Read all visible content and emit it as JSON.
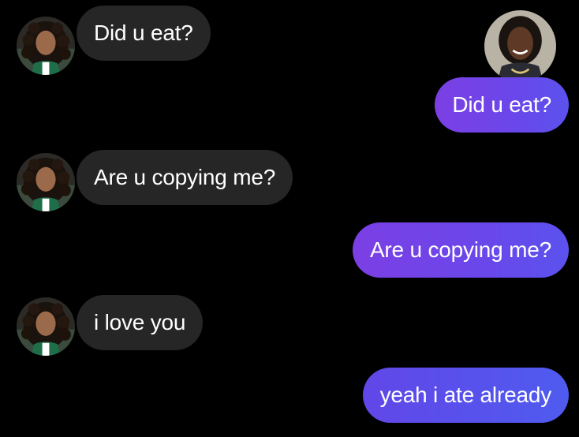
{
  "messages": [
    {
      "id": "m1",
      "side": "incoming",
      "text": "Did u eat?"
    },
    {
      "id": "m2",
      "side": "outgoing",
      "text": "Did u eat?"
    },
    {
      "id": "m3",
      "side": "incoming",
      "text": "Are u copying me?"
    },
    {
      "id": "m4",
      "side": "outgoing",
      "text": "Are u copying me?"
    },
    {
      "id": "m5",
      "side": "incoming",
      "text": "i love you"
    },
    {
      "id": "m6",
      "side": "outgoing",
      "text": "yeah i ate already"
    }
  ],
  "colors": {
    "background": "#000000",
    "incoming_bubble": "#262626",
    "outgoing_bubble_start": "#7b3fe4",
    "outgoing_bubble_end": "#5b52ee",
    "text": "#ffffff"
  },
  "icons": {
    "contact_avatar": "contact-avatar-icon",
    "self_avatar": "self-avatar-icon"
  }
}
